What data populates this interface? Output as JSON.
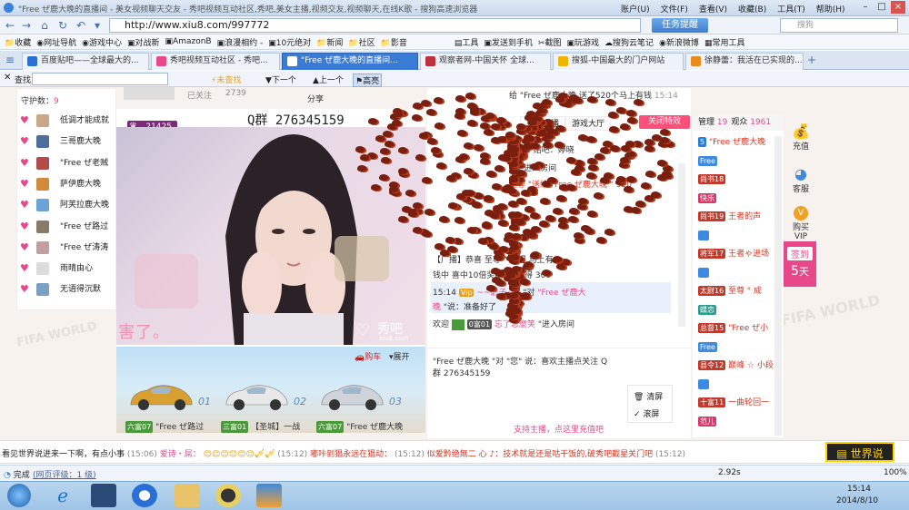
{
  "browser": {
    "title": "\"Free ぜ鹿大晚的直播间 - 美女视频聊天交友 - 秀吧视频互动社区,秀吧,美女主播,视频交友,视频聊天,在线K歌 - 搜狗高速浏览器",
    "menus": [
      "账户(U)",
      "文件(F)",
      "查看(V)",
      "收藏(B)",
      "工具(T)",
      "帮助(H)"
    ],
    "url": "http://www.xiu8.com/997772",
    "task_helper": "任务提醒",
    "task_count": "3",
    "search_placeholder": "搜狗",
    "favorites": [
      "收藏",
      "网址导航",
      "游戏中心",
      "对战新",
      "AmazonB",
      "浪漫相约 -",
      "10元绝对",
      "新闻",
      "社区",
      "影音",
      "工具",
      "发送到手机",
      "截图",
      "玩游戏",
      "搜狗云笔记",
      "新浪微博",
      "常用工具"
    ],
    "tabs": [
      {
        "label": "百度贴吧——全球最大的...",
        "color": "#2a6fd6"
      },
      {
        "label": "秀吧视频互动社区 - 秀吧...",
        "color": "#e8488a"
      },
      {
        "label": "\"Free ぜ鹿大晚的直播间...",
        "color": "#e8488a"
      },
      {
        "label": "观察者网-中国关怀 全球...",
        "color": "#c0303a"
      },
      {
        "label": "搜狐-中国最大的门户网站",
        "color": "#f1b400"
      },
      {
        "label": "徐静蕾：我活在已实现的...",
        "color": "#e98b1d"
      }
    ],
    "find": {
      "label": "查找:",
      "not_found": "未查找",
      "next": "下一个",
      "prev": "上一个",
      "highlight": "高亮"
    }
  },
  "guardians": {
    "count_label": "守护数：",
    "count": "9",
    "items": [
      {
        "name": "低调才能成就",
        "color": "#c9a889"
      },
      {
        "name": "三哥鹿大晚",
        "color": "#4d6d9a"
      },
      {
        "name": "\"Free ぜ老贼",
        "color": "#b34a4a"
      },
      {
        "name": "萨伊鹿大晚",
        "color": "#d08a3a"
      },
      {
        "name": "阿芙拉鹿大晚",
        "color": "#6aa4d4"
      },
      {
        "name": "\"Free ぜ路过",
        "color": "#8a7a6a"
      },
      {
        "name": "\"Free ぜ涛涛",
        "color": "#c3a0a0"
      },
      {
        "name": "雨晴由心",
        "color": "#dcdcdc"
      },
      {
        "name": "无语得沉默",
        "color": "#7aa0c4"
      }
    ]
  },
  "stream": {
    "top_follow": "已关注",
    "top_count": "2739",
    "share": "分享",
    "fans": "21425",
    "qq_group": "Q群 276345159",
    "caption": "害了。",
    "logo_text": "秀吧",
    "logo_sub": "xiu8.com",
    "car_label": "购车",
    "expand": "展开",
    "cars": [
      {
        "num": "01",
        "color": "#d8a030",
        "level": "六富07",
        "owner": "\"Free ぜ路过"
      },
      {
        "num": "02",
        "color": "#e8e8e8",
        "level": "三富01",
        "owner": "【圣城】一战"
      },
      {
        "num": "03",
        "color": "#d0d4da",
        "level": "六富07",
        "owner": "\"Free ぜ鹿大晚"
      }
    ]
  },
  "chat": {
    "gift_notice": "给 \"Free ぜ鹿大晚 送了520个马上有钱",
    "gift_time": "15:14",
    "tabs": [
      "更多主播",
      "游戏大厅"
    ],
    "close_fx": "关闭特效",
    "line_post": "9  贴吧：婷晓",
    "line_enter": "\"进入房间",
    "line_send": "至尊  \"送给 \"Free ぜ鹿大晚 \" 520",
    "line_broadcast": "【广播】恭喜  至尊 \"  获得  马上有",
    "line_broadcast2": "钱中 喜中10倍奖6次，获得 300",
    "hl_time": "15:14",
    "hl_user": "~~影子~~",
    "hl_to": "\"对",
    "hl_target": "\"Free ぜ鹿大",
    "hl_target2": "晚",
    "hl_say": "\"说：准备好了",
    "welcome": "欢迎",
    "welcome_level": "0富01",
    "welcome_name": "忘了怎麼笑",
    "welcome_enter": "\"进入房间",
    "lower_1": "\"Free ぜ鹿大晚 \"对 \"您\" 说：喜欢主播点关注 Q",
    "lower_2": "群 276345159",
    "clear": "清屏",
    "scroll": "滚屏",
    "support": "支持主播，点这里充值吧"
  },
  "audience": {
    "tab_manage": "管理",
    "manage_count": "19",
    "tab_viewers": "观众",
    "viewers_count": "1961",
    "rows": [
      {
        "badge": "5",
        "badge_color": "#2a7fd6",
        "name": "\"Free ぜ鹿大晚"
      },
      {
        "badge": "Free",
        "badge_color": "#3d8ae0",
        "name": ""
      },
      {
        "badge": "尚书18",
        "badge_color": "#c0392b",
        "name": ""
      },
      {
        "badge": "快乐",
        "badge_color": "#d23c6b",
        "name": ""
      },
      {
        "badge": "尚书19",
        "badge_color": "#c0392b",
        "name": "王者的声"
      },
      {
        "badge": "",
        "badge_color": "#3d8ae0",
        "name": ""
      },
      {
        "badge": "将军17",
        "badge_color": "#c0392b",
        "name": "王者ゃ进场"
      },
      {
        "badge": "",
        "badge_color": "#3d8ae0",
        "name": ""
      },
      {
        "badge": "太尉16",
        "badge_color": "#c0392b",
        "name": "至尊 \" 成"
      },
      {
        "badge": "蝶恋",
        "badge_color": "#2a9d8f",
        "name": ""
      },
      {
        "badge": "总督15",
        "badge_color": "#c0392b",
        "name": "\"Free ぜ小"
      },
      {
        "badge": "Free",
        "badge_color": "#3d8ae0",
        "name": ""
      },
      {
        "badge": "县令12",
        "badge_color": "#c0392b",
        "name": "巅峰 ☆ 小段"
      },
      {
        "badge": "",
        "badge_color": "#3d8ae0",
        "name": ""
      },
      {
        "badge": "十富11",
        "badge_color": "#c0392b",
        "name": "一曲轮回一"
      },
      {
        "badge": "范儿",
        "badge_color": "#d23c6b",
        "name": ""
      }
    ]
  },
  "side": {
    "recharge": "充值",
    "service": "客服",
    "vip": "购买VIP",
    "checkin": "签到",
    "checkin_days": "5",
    "checkin_unit": "天"
  },
  "marquee": {
    "items": [
      "看见世界说进来一下啊，有点小事",
      "(15:06)",
      "爱诗・屌：",
      "(15:12)",
      "嘟咔到猖永远在猖动：",
      "(15:12)",
      "似爱黔绝無二 心 ♪：技术就是还是咕干饭的,破秀吧截星关门吧",
      "(15:12)"
    ],
    "world_say": "世界说"
  },
  "status": {
    "done": "完成",
    "rating": "(网页评级：1 级)",
    "speed": "2.92s",
    "zoom": "100%"
  },
  "taskbar": {
    "time": "15:14",
    "date": "2014/8/10"
  }
}
